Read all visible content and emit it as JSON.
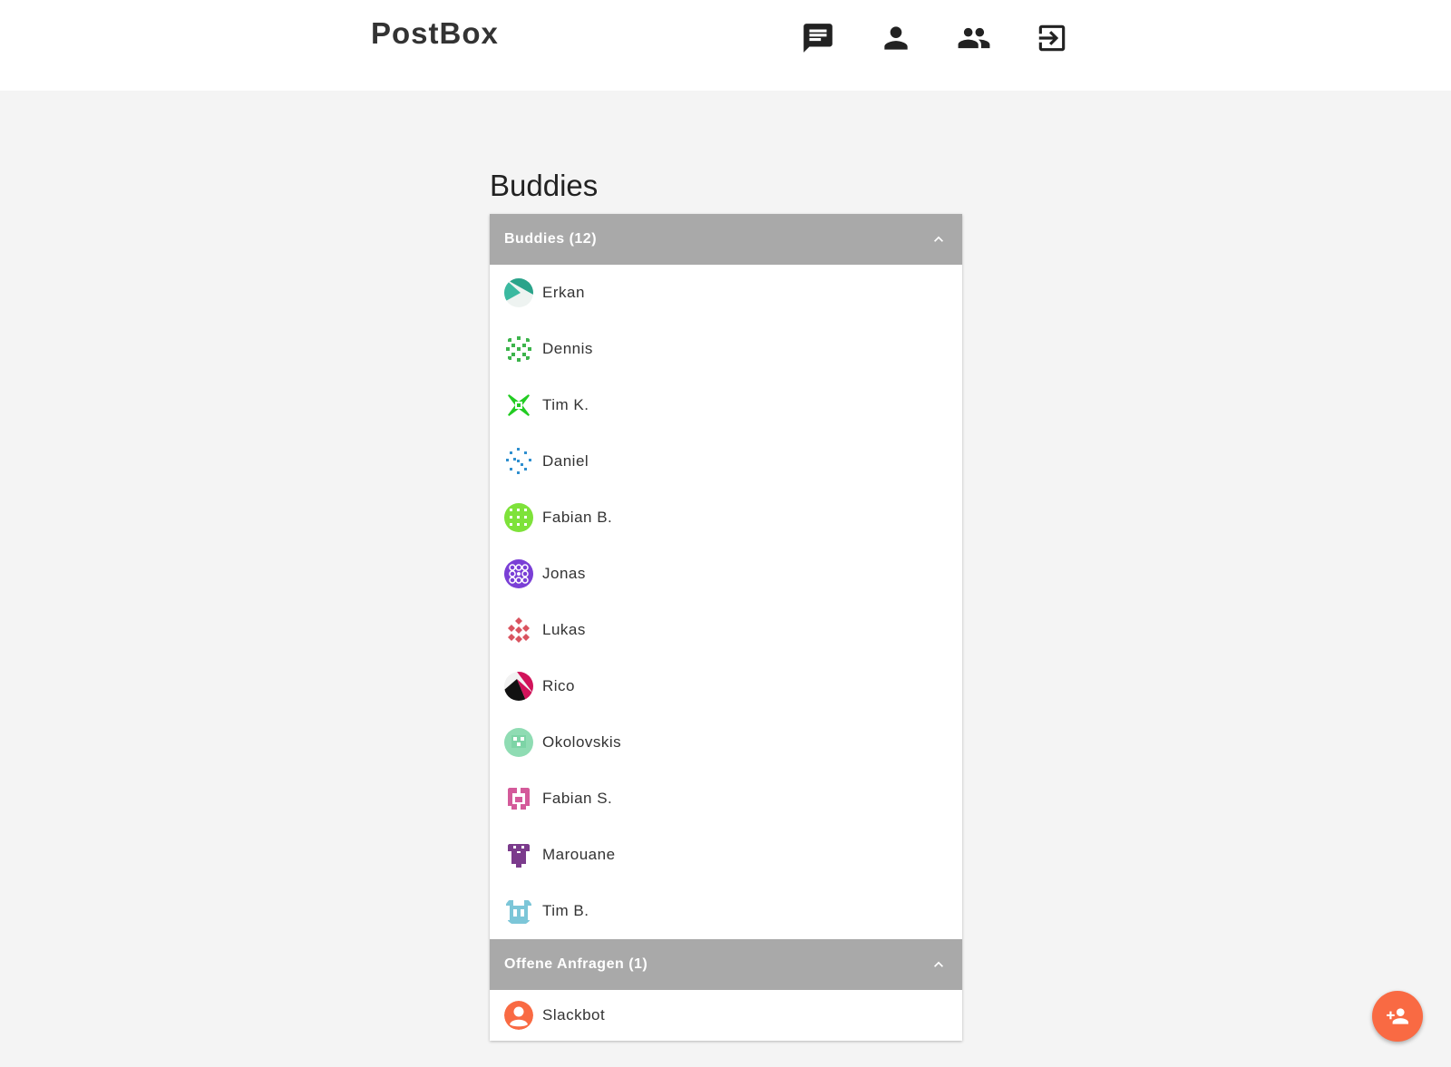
{
  "app": {
    "brand": "PostBox"
  },
  "nav": {
    "items": [
      {
        "icon": "chat-icon"
      },
      {
        "icon": "person-icon"
      },
      {
        "icon": "people-icon"
      },
      {
        "icon": "exit-icon"
      }
    ]
  },
  "page": {
    "title": "Buddies"
  },
  "buddies_section": {
    "title": "Buddies (12)",
    "expanded": true,
    "items": [
      {
        "name": "Erkan",
        "avatar_color": "#2aa38a"
      },
      {
        "name": "Dennis",
        "avatar_color": "#3cb44b"
      },
      {
        "name": "Tim K.",
        "avatar_color": "#22cc22"
      },
      {
        "name": "Daniel",
        "avatar_color": "#2f8fcf"
      },
      {
        "name": "Fabian B.",
        "avatar_color": "#7ee23a"
      },
      {
        "name": "Jonas",
        "avatar_color": "#7a3fd6"
      },
      {
        "name": "Lukas",
        "avatar_color": "#d9535f"
      },
      {
        "name": "Rico",
        "avatar_color": "#d1135a"
      },
      {
        "name": "Okolovskis",
        "avatar_color": "#8fdcb3"
      },
      {
        "name": "Fabian S.",
        "avatar_color": "#d45a9a"
      },
      {
        "name": "Marouane",
        "avatar_color": "#7b3b8c"
      },
      {
        "name": "Tim B.",
        "avatar_color": "#7cc6d8"
      }
    ]
  },
  "requests_section": {
    "title": "Offene Anfragen (1)",
    "expanded": true,
    "items": [
      {
        "name": "Slackbot",
        "avatar_color": "#f96a43"
      }
    ]
  },
  "fab": {
    "icon": "person-add-icon",
    "color": "#f96a43"
  }
}
